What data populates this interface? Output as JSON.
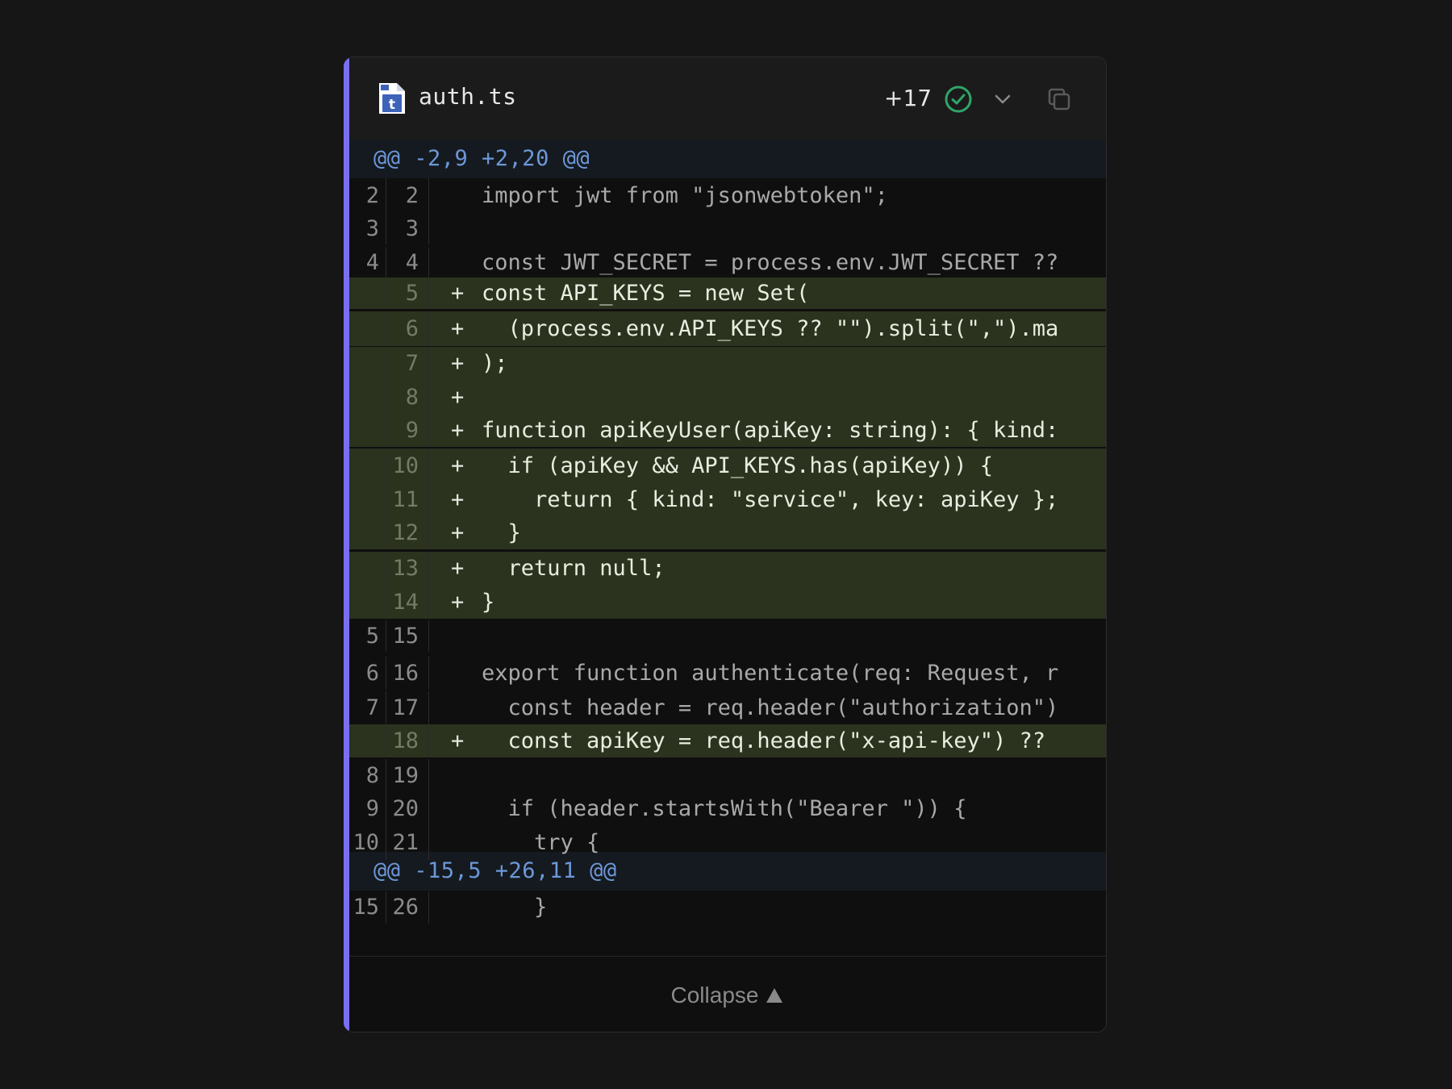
{
  "file": {
    "name": "auth.ts",
    "added": "+17",
    "icon": "typescript-file-icon"
  },
  "hunks": [
    "@@ -2,9 +2,20 @@",
    "@@ -15,5 +26,11 @@"
  ],
  "lines": [
    {
      "old": "2",
      "new": "2",
      "mark": "",
      "code": "import jwt from \"jsonwebtoken\";",
      "type": "ctx"
    },
    {
      "old": "3",
      "new": "3",
      "mark": "",
      "code": "",
      "type": "ctx"
    },
    {
      "old": "4",
      "new": "4",
      "mark": "",
      "code": "const JWT_SECRET = process.env.JWT_SECRET ??",
      "type": "ctx"
    },
    {
      "old": "",
      "new": "5",
      "mark": "+",
      "code": "const API_KEYS = new Set(",
      "type": "add"
    },
    {
      "old": "",
      "new": "6",
      "mark": "+",
      "code": "  (process.env.API_KEYS ?? \"\").split(\",\").ma",
      "type": "add"
    },
    {
      "old": "",
      "new": "7",
      "mark": "+",
      "code": ");",
      "type": "add"
    },
    {
      "old": "",
      "new": "8",
      "mark": "+",
      "code": "",
      "type": "add"
    },
    {
      "old": "",
      "new": "9",
      "mark": "+",
      "code": "function apiKeyUser(apiKey: string): { kind:",
      "type": "add"
    },
    {
      "old": "",
      "new": "10",
      "mark": "+",
      "code": "  if (apiKey && API_KEYS.has(apiKey)) {",
      "type": "add"
    },
    {
      "old": "",
      "new": "11",
      "mark": "+",
      "code": "    return { kind: \"service\", key: apiKey };",
      "type": "add"
    },
    {
      "old": "",
      "new": "12",
      "mark": "+",
      "code": "  }",
      "type": "add"
    },
    {
      "old": "",
      "new": "13",
      "mark": "+",
      "code": "  return null;",
      "type": "add"
    },
    {
      "old": "",
      "new": "14",
      "mark": "+",
      "code": "}",
      "type": "add"
    },
    {
      "old": "5",
      "new": "15",
      "mark": "",
      "code": "",
      "type": "ctx"
    },
    {
      "old": "6",
      "new": "16",
      "mark": "",
      "code": "export function authenticate(req: Request, r",
      "type": "ctx"
    },
    {
      "old": "7",
      "new": "17",
      "mark": "",
      "code": "  const header = req.header(\"authorization\")",
      "type": "ctx"
    },
    {
      "old": "",
      "new": "18",
      "mark": "+",
      "code": "  const apiKey = req.header(\"x-api-key\") ??",
      "type": "add"
    },
    {
      "old": "8",
      "new": "19",
      "mark": "",
      "code": "",
      "type": "ctx"
    },
    {
      "old": "9",
      "new": "20",
      "mark": "",
      "code": "  if (header.startsWith(\"Bearer \")) {",
      "type": "ctx"
    },
    {
      "old": "10",
      "new": "21",
      "mark": "",
      "code": "    try {",
      "type": "ctx"
    },
    {
      "old": "15",
      "new": "26",
      "mark": "",
      "code": "    }",
      "type": "ctx"
    }
  ],
  "footer": {
    "collapse_label": "Collapse"
  },
  "colors": {
    "accent": "#7a6ff0",
    "added_bg": "#2b331f",
    "hunk_fg": "#6c98d8",
    "check": "#2fa56a"
  }
}
